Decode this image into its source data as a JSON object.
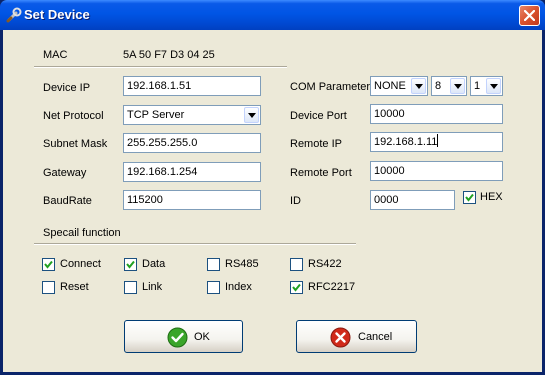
{
  "window": {
    "title": "Set Device"
  },
  "mac": {
    "label": "MAC",
    "value": "5A 50 F7 D3 04 25"
  },
  "left_fields": {
    "device_ip": {
      "label": "Device IP",
      "value": "192.168.1.51"
    },
    "net_protocol": {
      "label": "Net Protocol",
      "value": "TCP Server"
    },
    "subnet_mask": {
      "label": "Subnet Mask",
      "value": "255.255.255.0"
    },
    "gateway": {
      "label": "Gateway",
      "value": "192.168.1.254"
    },
    "baudrate": {
      "label": "BaudRate",
      "value": "115200"
    }
  },
  "right_fields": {
    "com_parameter": {
      "label": "COM Parameter",
      "parity": "NONE",
      "data_bits": "8",
      "stop_bits": "1"
    },
    "device_port": {
      "label": "Device Port",
      "value": "10000"
    },
    "remote_ip": {
      "label": "Remote IP",
      "value": "192.168.1.11"
    },
    "remote_port": {
      "label": "Remote Port",
      "value": "10000"
    },
    "id": {
      "label": "ID",
      "value": "0000"
    },
    "hex": {
      "label": "HEX",
      "checked": true
    }
  },
  "special": {
    "heading": "Specail function",
    "options": [
      {
        "label": "Connect",
        "checked": true
      },
      {
        "label": "Data",
        "checked": true
      },
      {
        "label": "RS485",
        "checked": false
      },
      {
        "label": "RS422",
        "checked": false
      },
      {
        "label": "Reset",
        "checked": false
      },
      {
        "label": "Link",
        "checked": false
      },
      {
        "label": "Index",
        "checked": false
      },
      {
        "label": "RFC2217",
        "checked": true
      }
    ]
  },
  "buttons": {
    "ok": "OK",
    "cancel": "Cancel"
  },
  "icons": {
    "title": "tools-icon",
    "close": "close-icon",
    "ok": "check-circle-icon",
    "cancel": "x-circle-icon"
  },
  "colors": {
    "title_bar": "#0054e3",
    "dialog_bg": "#ece9d8",
    "close_button": "#d9522e",
    "ok_icon": "#3aa52a",
    "cancel_icon": "#d02a1a"
  }
}
